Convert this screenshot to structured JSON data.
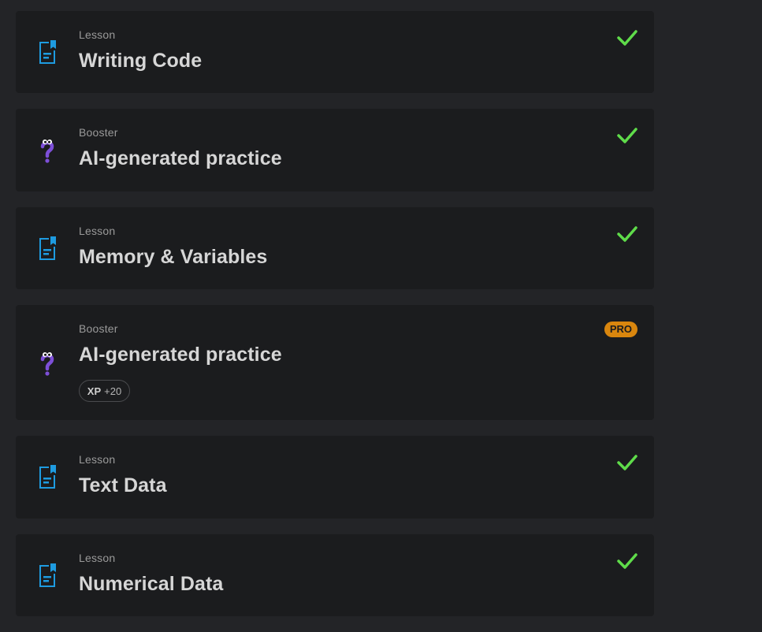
{
  "items": [
    {
      "type": "Lesson",
      "title": "Writing Code",
      "icon": "lesson-document-icon",
      "status": "completed"
    },
    {
      "type": "Booster",
      "title": "AI-generated practice",
      "icon": "question-mark-mascot-icon",
      "status": "completed"
    },
    {
      "type": "Lesson",
      "title": "Memory & Variables",
      "icon": "lesson-document-icon",
      "status": "completed"
    },
    {
      "type": "Booster",
      "title": "AI-generated practice",
      "icon": "question-mark-mascot-icon",
      "status": "locked",
      "badge": "PRO",
      "xp_label": "XP",
      "xp_value": "+20"
    },
    {
      "type": "Lesson",
      "title": "Text Data",
      "icon": "lesson-document-icon",
      "status": "completed"
    },
    {
      "type": "Lesson",
      "title": "Numerical Data",
      "icon": "lesson-document-icon",
      "status": "completed"
    }
  ],
  "colors": {
    "background": "#232427",
    "card": "#1b1c1e",
    "lesson_icon": "#1e9be0",
    "booster_icon": "#7d4fd8",
    "check": "#5fdc4a",
    "pro_badge": "#d9860e"
  }
}
